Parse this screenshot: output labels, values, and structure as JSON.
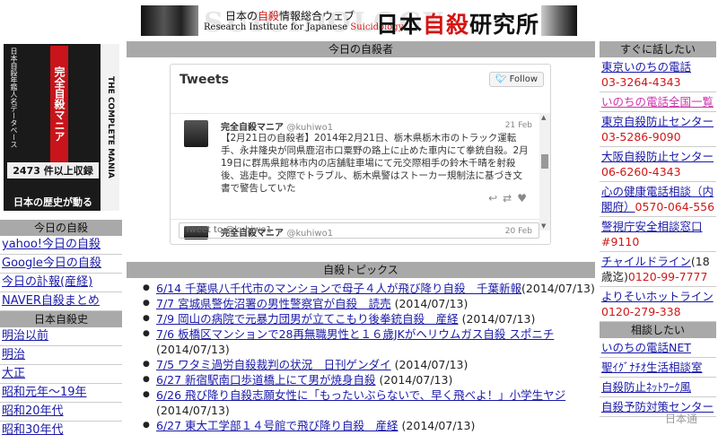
{
  "banner": {
    "ghost": "SUICIDOLOGY",
    "line1_pre": "日本の",
    "line1_red": "自殺",
    "line1_post": "情報総合ウェブ",
    "line2_pre": "Research Institute for Japanese ",
    "line2_red": "Suicidology",
    "big_pre": "日本",
    "big_red": "自殺",
    "big_post": "研究所"
  },
  "book": {
    "left_text": "日本自殺年鑑人名データベース",
    "red_title": "完全自殺マニア",
    "stripe": "THE COMPLETE MANIA",
    "count": "2473 件以上収録",
    "bottom": "日本の歴史が動る"
  },
  "left": {
    "section1": "今日の自殺",
    "links1": [
      "yahoo!今日の自殺",
      "Google今日の自殺",
      "今日の訃報(産経)",
      "NAVER自殺まとめ"
    ],
    "section2": "日本自殺史",
    "links2": [
      "明治以前",
      "明治",
      "大正",
      "昭和元年～19年",
      "昭和20年代",
      "昭和30年代"
    ]
  },
  "middle": {
    "section1": "今日の自殺者",
    "widget": {
      "title": "Tweets",
      "follow": "Follow",
      "tweets": [
        {
          "name": "完全自殺マニア",
          "handle": "@kuhiwo1",
          "date": "21 Feb",
          "text": "【2月21日の自殺者】2014年2月21日、栃木県栃木市のトラック運転手、永井隆央が同県鹿沼市口粟野の路上に止めた車内にて拳銃自殺。2月19日に群馬県館林市内の店舗駐車場にて元交際相手の鈴木千晴を射殺後、逃走中。交際でトラブル、栃木県警はストーカー規制法に基づき文書で警告していた"
        },
        {
          "name": "完全自殺マニア",
          "handle": "@kuhiwo1",
          "date": "20 Feb",
          "text": ""
        }
      ],
      "reply": "Tweet to @kuhiwo1"
    },
    "section2": "自殺トピックス",
    "topics": [
      {
        "link": "6/14 千葉県八千代市のマンションで母子４人が飛び降り自殺　千葉新報",
        "date": "(2014/07/13)"
      },
      {
        "link": "7/7 宮城県警佐沼署の男性警察官が自殺　読売",
        "date": "(2014/07/13)"
      },
      {
        "link": "7/9 岡山の病院で元暴力団男が立てこもり後拳銃自殺　産経",
        "date": "(2014/07/13)"
      },
      {
        "link": "7/6 板橋区マンションで28再無職男性と１６歳JKがヘリウムガス自殺 スポニチ",
        "date": "(2014/07/13)"
      },
      {
        "link": "7/5 ワタミ過労自殺裁判の状況　日刊ゲンダイ",
        "date": "(2014/07/13)"
      },
      {
        "link": "6/27 新宿駅南口歩道橋上にて男が焼身自殺",
        "date": "(2014/07/13)"
      },
      {
        "link": "6/26 飛び降り自殺志願女性に「もったいぶらないで、早く飛べよ！」小学生ヤジ",
        "date": "(2014/07/13)"
      },
      {
        "link": "6/27 東大工学部１４号館で飛び降り自殺　産経",
        "date": "(2014/07/13)"
      }
    ]
  },
  "right": {
    "section1": "すぐに話したい",
    "items": [
      {
        "name": "東京いのちの電話",
        "tel": "03-3264-4343",
        "style": "normal"
      },
      {
        "name": "いのちの電話全国一覧",
        "tel": "",
        "style": "pink"
      },
      {
        "name": "東京自殺防止センター",
        "tel": "03-5286-9090",
        "style": "normal"
      },
      {
        "name": "大阪自殺防止センター",
        "tel": "06-6260-4343",
        "style": "normal"
      },
      {
        "name": "心の健康電話相談（内閣府）",
        "tel": "0570-064-556",
        "style": "normal"
      },
      {
        "name": "警視庁安全相談窓口",
        "tel": "#9110",
        "style": "normal"
      },
      {
        "name": "チャイルドライン",
        "note": "(18歳迄)",
        "tel": "0120-99-7777",
        "style": "normal"
      },
      {
        "name": "よりそいホットライン",
        "tel": "0120-279-338",
        "style": "normal"
      }
    ],
    "section2": "相談したい",
    "items2": [
      "いのちの電話NET",
      "聖ｲｸﾞﾅﾁｵ生活相談室",
      "自殺防止ﾈｯﾄﾜｰｸ風",
      "自殺予防対策センター"
    ]
  },
  "watermark": "日本通"
}
